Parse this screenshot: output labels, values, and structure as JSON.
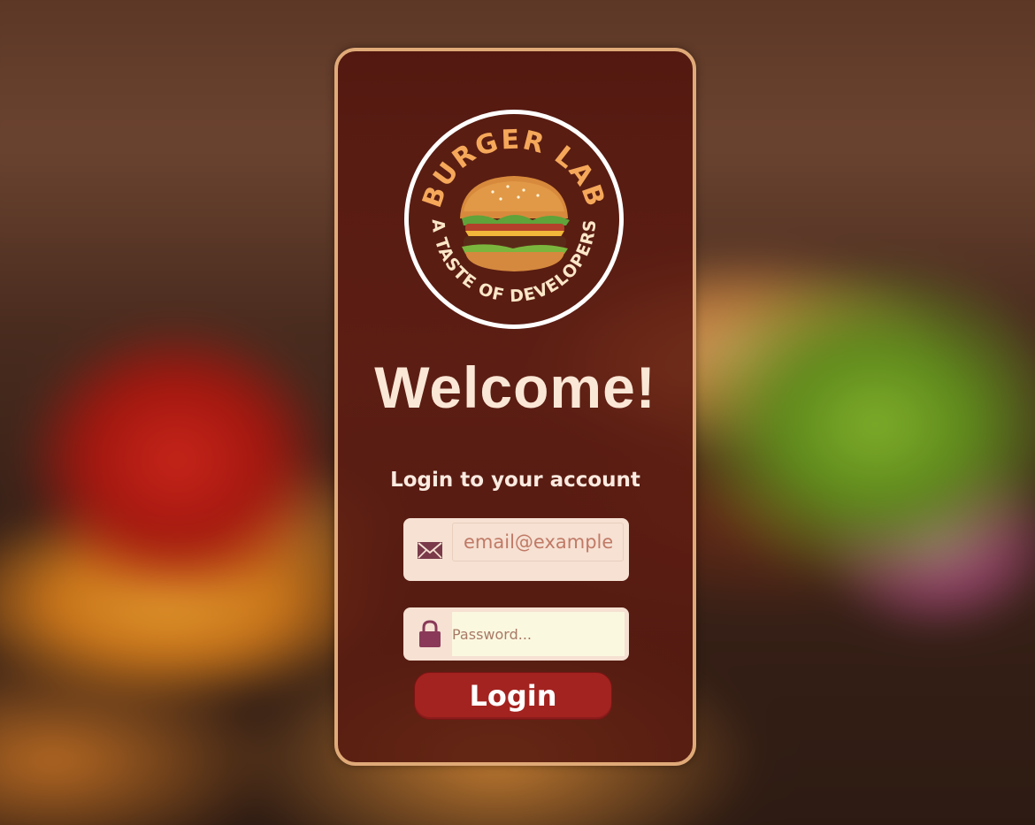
{
  "brand": {
    "name": "BURGER LAB",
    "tagline": "A TASTE OF DEVELOPERS"
  },
  "welcome": "Welcome!",
  "subtitle": "Login to your account",
  "email": {
    "placeholder": "email@example",
    "icon": "envelope-icon"
  },
  "password": {
    "placeholder": "Password...",
    "icon": "lock-icon"
  },
  "login_button": "Login",
  "colors": {
    "card_border": "#e0aa78",
    "card_bg": "#5a1a10",
    "button": "#a32320",
    "field_bg": "#f6e1d3",
    "brand_text": "#f5a85a",
    "tagline_text": "#fbe7c8"
  }
}
